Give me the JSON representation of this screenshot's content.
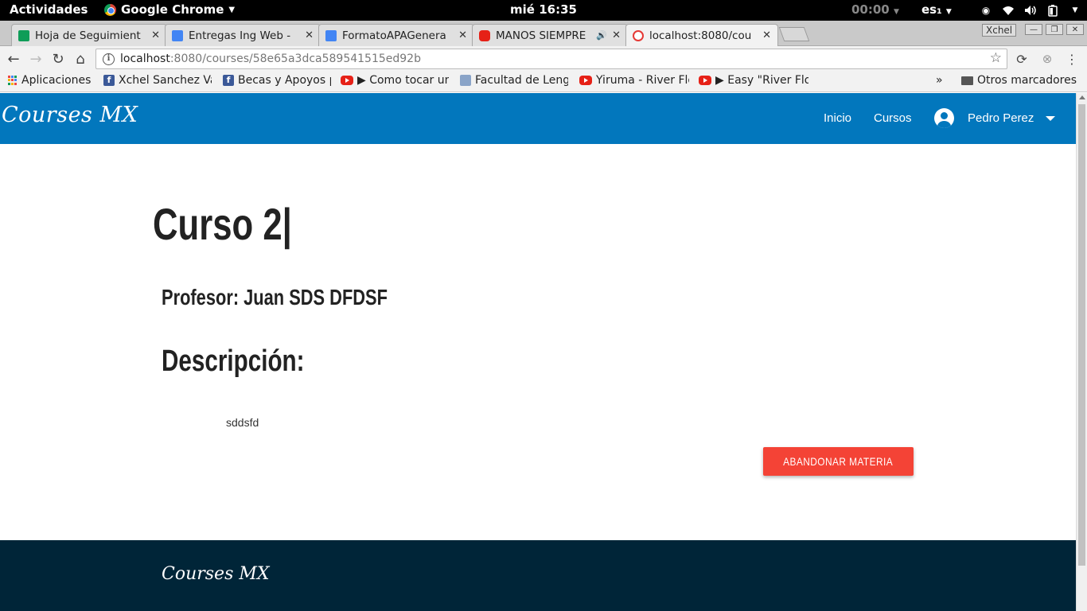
{
  "system_bar": {
    "activities": "Actividades",
    "app_name": "Google Chrome",
    "clock": "mié 16:35",
    "timer": "00:00",
    "language": "es₁"
  },
  "browser": {
    "tabs": [
      {
        "title": "Hoja de Seguimient",
        "icon": "sheets-icon",
        "color": "#0f9d58"
      },
      {
        "title": "Entregas Ing Web -",
        "icon": "docs-icon",
        "color": "#4285f4"
      },
      {
        "title": "FormatoAPAGenera",
        "icon": "docs-icon",
        "color": "#4285f4"
      },
      {
        "title": "MANOS SIEMPRE",
        "icon": "youtube-icon",
        "color": "#e62117"
      },
      {
        "title": "localhost:8080/cou",
        "icon": "localhost-icon",
        "color": "#e53935"
      }
    ],
    "window_user": "Xchel",
    "url_host": "localhost",
    "url_path": ":8080/courses/58e65a3dca589541515ed92b",
    "bookmarks": [
      {
        "label": "Aplicaciones",
        "icon": "apps-icon"
      },
      {
        "label": "Xchel Sanchez Va",
        "icon": "facebook-icon"
      },
      {
        "label": "Becas y Apoyos p",
        "icon": "facebook-icon"
      },
      {
        "label": "▶ Como tocar un",
        "icon": "youtube-icon"
      },
      {
        "label": "Facultad de Leng",
        "icon": "faculty-icon"
      },
      {
        "label": "Yiruma - River Flo",
        "icon": "youtube-icon"
      },
      {
        "label": "▶ Easy \"River Flo",
        "icon": "youtube-icon"
      }
    ],
    "more_bookmarks": "»",
    "other_bookmarks": "Otros marcadores"
  },
  "site": {
    "brand": "Courses MX",
    "nav": {
      "home": "Inicio",
      "courses": "Cursos",
      "user_name": "Pedro Perez"
    },
    "colors": {
      "navbar": "#0277bd",
      "button": "#f44336",
      "footer": "#002538"
    }
  },
  "course": {
    "title": "Curso 2|",
    "professor": "Profesor: Juan SDS DFDSF",
    "description_heading": "Descripción:",
    "description": "sddsfd",
    "drop_button": "ABANDONAR MATERIA"
  },
  "footer": {
    "brand": "Courses MX"
  }
}
